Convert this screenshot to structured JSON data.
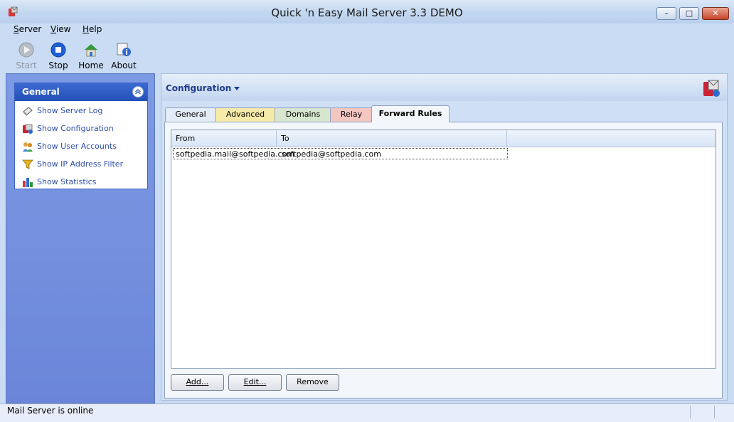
{
  "window": {
    "title": "Quick 'n Easy Mail Server 3.3 DEMO",
    "controls": {
      "minimize": "–",
      "maximize": "□",
      "close": "✕"
    }
  },
  "menu": [
    "Server",
    "View",
    "Help"
  ],
  "toolbar": {
    "start": {
      "label": "Start",
      "icon": "play-icon",
      "enabled": false
    },
    "stop": {
      "label": "Stop",
      "icon": "stop-icon"
    },
    "home": {
      "label": "Home",
      "icon": "home-icon"
    },
    "about": {
      "label": "About",
      "icon": "info-icon"
    }
  },
  "sidebar": {
    "group_title": "General",
    "items": [
      {
        "label": "Show Server Log",
        "icon": "log-icon"
      },
      {
        "label": "Show Configuration",
        "icon": "configuration-icon"
      },
      {
        "label": "Show User Accounts",
        "icon": "users-icon"
      },
      {
        "label": "Show IP Address Filter",
        "icon": "filter-icon"
      },
      {
        "label": "Show Statistics",
        "icon": "statistics-icon"
      }
    ]
  },
  "main": {
    "title": "Configuration",
    "tabs": [
      {
        "label": "General",
        "color": "#e4ecf7"
      },
      {
        "label": "Advanced",
        "color": "#f6eaa8"
      },
      {
        "label": "Domains",
        "color": "#d8e6d0"
      },
      {
        "label": "Relay",
        "color": "#f4c6c2"
      },
      {
        "label": "Forward Rules",
        "color": "#f3f6fb",
        "active": true
      }
    ],
    "columns": [
      "From",
      "To"
    ],
    "rows": [
      {
        "from": "softpedia.mail@softpedia.com",
        "to": "softpedia@softpedia.com"
      }
    ],
    "buttons": {
      "add": "Add...",
      "edit": "Edit...",
      "remove": "Remove"
    }
  },
  "status": {
    "text": "Mail Server is online"
  },
  "colors": {
    "accent": "#2450b6",
    "link": "#2e4fa8",
    "sidebar": "#7d9ae4"
  }
}
